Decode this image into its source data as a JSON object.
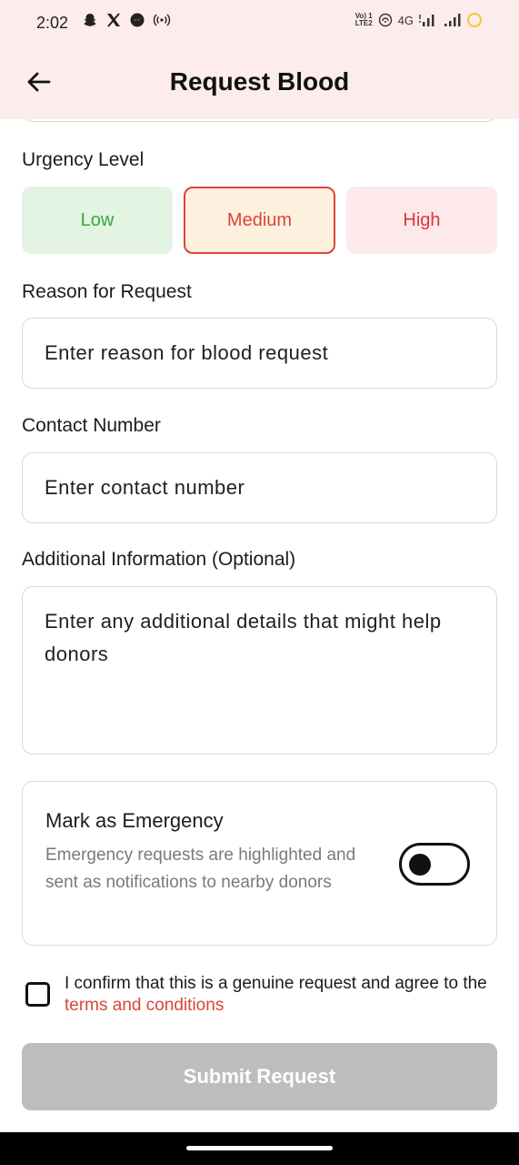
{
  "status_bar": {
    "time": "2:02",
    "left_icons": [
      "snapchat-icon",
      "x-icon",
      "messenger-icon",
      "hotspot-icon"
    ],
    "network_label_top": "Vo) 1",
    "network_label_bottom": "LTE2",
    "network_type": "4G",
    "right_icons": [
      "wifi-calling-icon",
      "signal-4g-icon",
      "signal-icon",
      "battery-icon"
    ]
  },
  "header": {
    "title": "Request Blood",
    "back_icon": "arrow-left-icon"
  },
  "urgency": {
    "label": "Urgency Level",
    "options": [
      {
        "label": "Low",
        "color": "#3aa53f",
        "bg": "#e3f4e3"
      },
      {
        "label": "Medium",
        "color": "#d9453a",
        "bg": "#fdf0df",
        "selected": true
      },
      {
        "label": "High",
        "color": "#e0353f",
        "bg": "#fde8ea"
      }
    ]
  },
  "reason": {
    "label": "Reason for Request",
    "placeholder": "Enter reason for blood request"
  },
  "contact": {
    "label": "Contact Number",
    "placeholder": "Enter contact number"
  },
  "additional": {
    "label": "Additional Information (Optional)",
    "placeholder": "Enter any additional details that might help donors"
  },
  "emergency": {
    "title": "Mark as Emergency",
    "description": "Emergency requests are highlighted and sent as notifications to nearby donors",
    "enabled": false
  },
  "confirm": {
    "text_before": "I confirm that this is a genuine request and agree to the ",
    "link_text": "terms and conditions",
    "checked": false
  },
  "submit": {
    "label": "Submit Request",
    "enabled": false
  },
  "colors": {
    "header_bg": "#fdecec",
    "accent_red": "#d9453a",
    "disabled_button": "#bdbdbd"
  }
}
